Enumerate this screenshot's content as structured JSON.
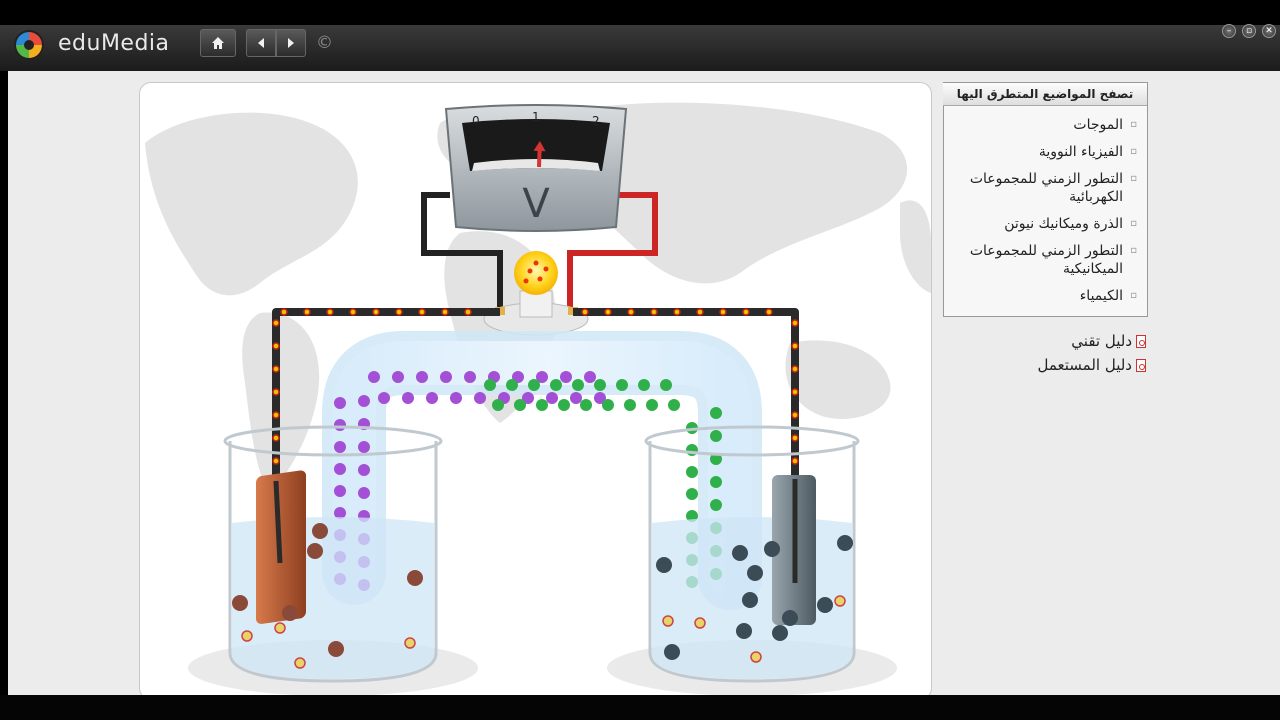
{
  "app": {
    "brand": "eduMedia",
    "copyright": "©",
    "nav": {
      "home_icon": "home-icon",
      "back_icon": "arrow-left-icon",
      "forward_icon": "arrow-right-icon"
    },
    "window_controls": [
      "minimize-icon",
      "restore-icon",
      "close-icon"
    ]
  },
  "simulation": {
    "voltmeter": {
      "scale_labels": [
        "0",
        "1",
        "2"
      ],
      "unit": "V",
      "reading": 1.05
    },
    "colors": {
      "copper": "#b65a35",
      "zinc": "#7d8a92",
      "anion": "#a34fd6",
      "cation": "#2fb04a",
      "electron": "#e8c400",
      "solution": "#cfe6f7"
    }
  },
  "sidebar": {
    "header": "تصفح المواضيع المتطرق اليها",
    "topics": [
      {
        "label": "الموجات"
      },
      {
        "label": "الفيزياء النووية"
      },
      {
        "label": "التطور الزمني للمجموعات الكهربائية"
      },
      {
        "label": "الذرة وميكانيك نيوتن"
      },
      {
        "label": "التطور الزمني للمجموعات الميكانيكية"
      },
      {
        "label": "الكيمياء"
      }
    ],
    "guides": [
      {
        "label": "دليل تقني",
        "icon": "pdf-icon"
      },
      {
        "label": "دليل المستعمل",
        "icon": "pdf-icon"
      }
    ]
  }
}
